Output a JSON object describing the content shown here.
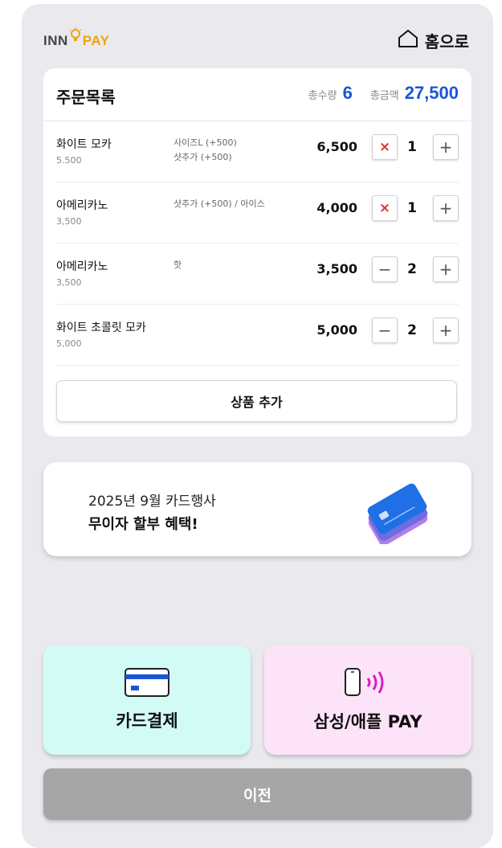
{
  "header": {
    "logo": {
      "part1": "INN",
      "part2": "PAY"
    },
    "home_label": "홈으로"
  },
  "order": {
    "title": "주문목록",
    "total_qty_label": "총수량",
    "total_qty": "6",
    "total_amount_label": "총금액",
    "total_amount": "27,500",
    "items": [
      {
        "name": "화이트 모카",
        "unit_price": "5.500",
        "options": "사이즈L (+500)\n샷추가 (+500)",
        "price": "6,500",
        "qty": "1",
        "minus_action": "delete",
        "minus_symbol": "×",
        "plus_symbol": "+"
      },
      {
        "name": "아메리카노",
        "unit_price": "3,500",
        "options": "샷추가 (+500) / 아이스",
        "price": "4,000",
        "qty": "1",
        "minus_action": "delete",
        "minus_symbol": "×",
        "plus_symbol": "+"
      },
      {
        "name": "아메리카노",
        "unit_price": "3,500",
        "options": "핫",
        "price": "3,500",
        "qty": "2",
        "minus_action": "decrease",
        "minus_symbol": "−",
        "plus_symbol": "+"
      },
      {
        "name": "화이트 초콜릿 모카",
        "unit_price": "5,000",
        "options": "",
        "price": "5,000",
        "qty": "2",
        "minus_action": "decrease",
        "minus_symbol": "−",
        "plus_symbol": "+"
      }
    ],
    "add_button": "상품 추가"
  },
  "promo": {
    "line1": "2025년 9월 카드행사",
    "line2": "무이자 할부 혜택!",
    "icon": "credit-cards-stack-icon"
  },
  "payment": {
    "card_label": "카드결제",
    "card_icon": "credit-card-icon",
    "mobile_label": "삼성/애플 PAY",
    "mobile_icon": "phone-nfc-icon"
  },
  "prev_button": "이전",
  "colors": {
    "accent": "#1a56d6",
    "logo": "#f2a20a",
    "card_bg": "#d3fbf6",
    "mobile_bg": "#fde3f8",
    "delete": "#e53030",
    "prev_bg": "#a6a6a6"
  }
}
